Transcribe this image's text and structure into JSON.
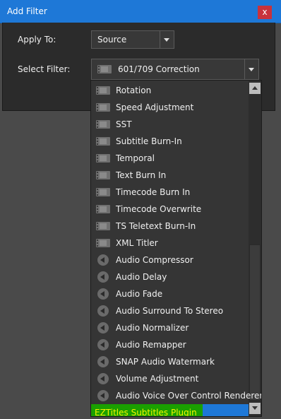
{
  "window": {
    "title": "Add Filter",
    "close_glyph": "x"
  },
  "apply_to": {
    "label": "Apply To:",
    "value": "Source"
  },
  "select_filter": {
    "label": "Select Filter:",
    "value": "601/709 Correction",
    "icon": "film-icon"
  },
  "filter_list": {
    "items": [
      {
        "label": "Rotation",
        "icon": "film-icon"
      },
      {
        "label": "Speed Adjustment",
        "icon": "film-icon"
      },
      {
        "label": "SST",
        "icon": "film-icon"
      },
      {
        "label": "Subtitle Burn-In",
        "icon": "film-icon"
      },
      {
        "label": "Temporal",
        "icon": "film-icon"
      },
      {
        "label": "Text Burn In",
        "icon": "film-icon"
      },
      {
        "label": "Timecode Burn In",
        "icon": "film-icon"
      },
      {
        "label": "Timecode Overwrite",
        "icon": "film-icon"
      },
      {
        "label": "TS Teletext Burn-In",
        "icon": "film-icon"
      },
      {
        "label": "XML Titler",
        "icon": "film-icon"
      },
      {
        "label": "Audio Compressor",
        "icon": "speaker-icon"
      },
      {
        "label": "Audio Delay",
        "icon": "speaker-icon"
      },
      {
        "label": "Audio Fade",
        "icon": "speaker-icon"
      },
      {
        "label": "Audio Surround To Stereo",
        "icon": "speaker-icon"
      },
      {
        "label": "Audio Normalizer",
        "icon": "speaker-icon"
      },
      {
        "label": "Audio Remapper",
        "icon": "speaker-icon"
      },
      {
        "label": "SNAP Audio Watermark",
        "icon": "speaker-icon"
      },
      {
        "label": "Volume Adjustment",
        "icon": "speaker-icon"
      },
      {
        "label": "Audio Voice Over Control Renderer",
        "icon": "speaker-icon"
      },
      {
        "label": "EZTitles Subtitles Plugin",
        "icon": "",
        "selected": true
      }
    ]
  },
  "colors": {
    "title_bar": "#1e78d7",
    "close_button": "#c8323c",
    "selection": "#1e78d7",
    "selected_highlight": "#1aa000",
    "selected_text": "#f4f400"
  }
}
